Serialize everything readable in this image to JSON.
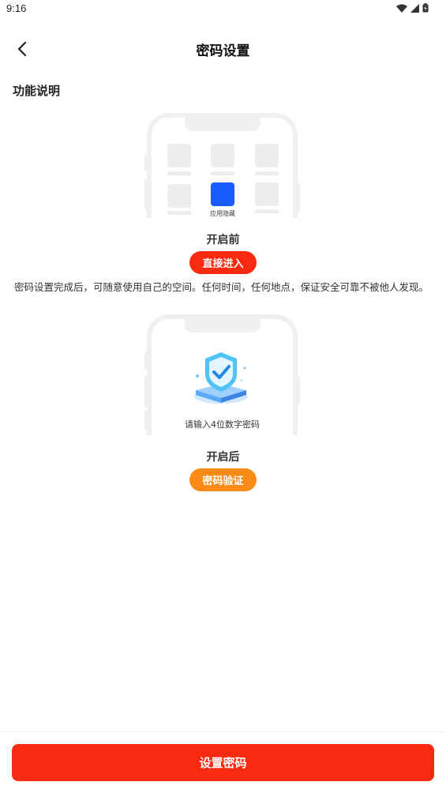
{
  "status_bar": {
    "time": "9:16"
  },
  "nav": {
    "title": "密码设置"
  },
  "section": {
    "title": "功能说明"
  },
  "before": {
    "hidden_app_label": "应用隐藏",
    "caption": "开启前",
    "badge": "直接进入"
  },
  "description": "密码设置完成后，可随意使用自己的空间。任何时间，任何地点，保证安全可靠不被他人发现。",
  "after": {
    "prompt": "请输入4位数字密码",
    "caption": "开启后",
    "badge": "密码验证"
  },
  "footer": {
    "button_label": "设置密码"
  },
  "colors": {
    "primary_red": "#fa2a10",
    "orange": "#f98b16",
    "blue": "#1a5cff"
  }
}
